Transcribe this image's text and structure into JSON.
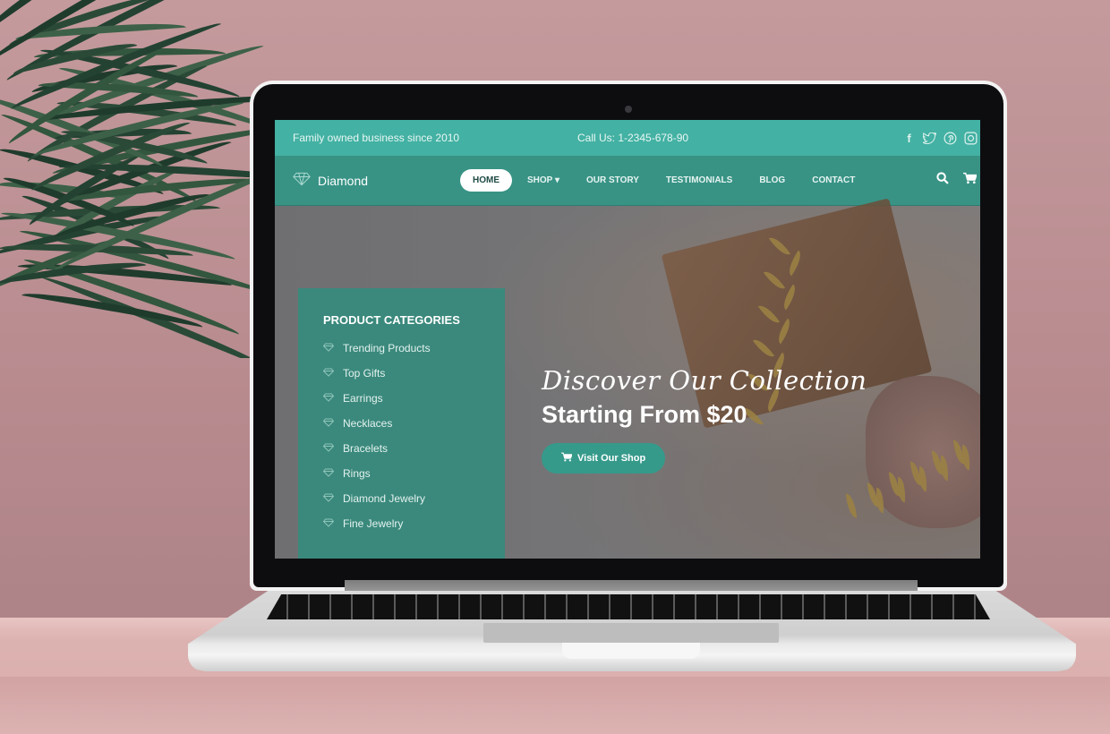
{
  "topbar": {
    "tagline": "Family owned business since 2010",
    "phone": "Call Us: 1-2345-678-90",
    "socials": [
      {
        "name": "facebook-icon",
        "glyph": "f"
      },
      {
        "name": "twitter-icon",
        "glyph": "ᵀ"
      },
      {
        "name": "pinterest-icon",
        "glyph": "ⓟ"
      },
      {
        "name": "instagram-icon",
        "glyph": "▢"
      }
    ]
  },
  "navbar": {
    "brand": "Diamond",
    "menu": [
      {
        "label": "HOME",
        "active": true
      },
      {
        "label": "SHOP ▾",
        "active": false
      },
      {
        "label": "OUR STORY",
        "active": false
      },
      {
        "label": "TESTIMONIALS",
        "active": false
      },
      {
        "label": "BLOG",
        "active": false
      },
      {
        "label": "CONTACT",
        "active": false
      }
    ]
  },
  "categories": {
    "title": "PRODUCT CATEGORIES",
    "items": [
      "Trending Products",
      "Top Gifts",
      "Earrings",
      "Necklaces",
      "Bracelets",
      "Rings",
      "Diamond Jewelry",
      "Fine Jewelry"
    ]
  },
  "hero": {
    "script_heading": "Discover Our Collection",
    "price_heading": "Starting From $20",
    "cta_label": "Visit Our Shop"
  },
  "colors": {
    "topbar": "#43b1a3",
    "navbar": "#389385",
    "panel": "#3a897c",
    "cta": "#369a8b"
  }
}
